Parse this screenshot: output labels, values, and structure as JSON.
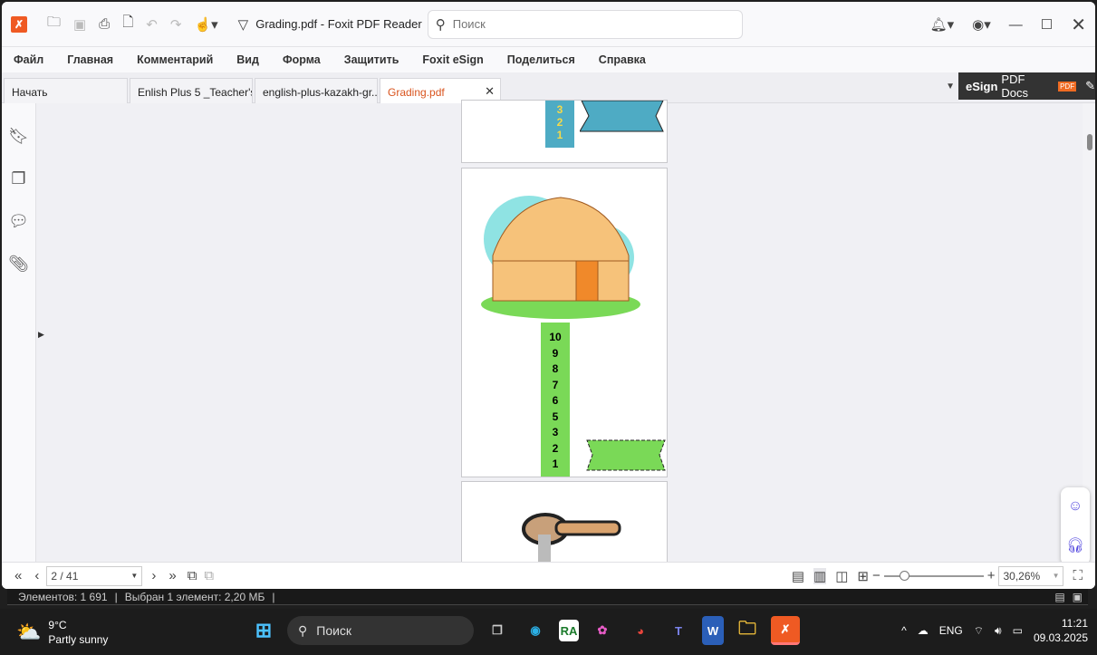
{
  "titlebar": {
    "title": "Grading.pdf - Foxit PDF Reader",
    "search_placeholder": "Поиск"
  },
  "menu": [
    "Файл",
    "Главная",
    "Комментарий",
    "Вид",
    "Форма",
    "Защитить",
    "Foxit eSign",
    "Поделиться",
    "Справка"
  ],
  "tabs": [
    {
      "label": "Начать"
    },
    {
      "label": "Enlish Plus 5 _Teacher's ..."
    },
    {
      "label": "english-plus-kazakh-gr..."
    },
    {
      "label": "Grading.pdf",
      "active": true
    }
  ],
  "esign": {
    "bold": "eSign",
    "rest": "PDF Docs",
    "badge": "PDF"
  },
  "document": {
    "page_prev_numbers": [
      "3",
      "2",
      "1"
    ],
    "scale_numbers": [
      "10",
      "9",
      "8",
      "7",
      "6",
      "5",
      "3",
      "2",
      "1"
    ],
    "colors": {
      "blue": "#4eabc4",
      "green": "#7ad957",
      "yellow": "#f5d94a"
    }
  },
  "bottombar": {
    "page": "2 / 41",
    "zoom": "30,26%",
    "zoom_fraction": 0.2
  },
  "status": {
    "items": "Элементов: 1 691",
    "selected": "Выбран 1 элемент: 2,20 МБ"
  },
  "taskbar": {
    "temp": "9°C",
    "weather": "Partly sunny",
    "search": "Поиск",
    "lang": "ENG",
    "time": "11:21",
    "date": "09.03.2025"
  },
  "accent": "#ef5a23"
}
